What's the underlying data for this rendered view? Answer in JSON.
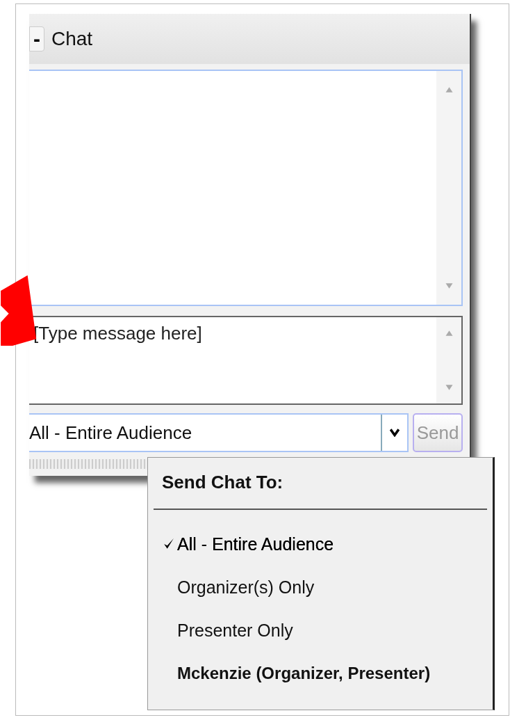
{
  "panel": {
    "title": "Chat",
    "collapse_symbol": "-"
  },
  "message_input": {
    "placeholder": "[Type message here]"
  },
  "recipient": {
    "value": "All - Entire Audience",
    "send_label": "Send",
    "send_disabled": true
  },
  "menu": {
    "title": "Send Chat To:",
    "items": [
      {
        "label": "All - Entire Audience",
        "selected": true,
        "kind": "group"
      },
      {
        "label": "Organizer(s) Only",
        "selected": false,
        "kind": "group"
      },
      {
        "label": "Presenter Only",
        "selected": false,
        "kind": "group"
      },
      {
        "label": "Mckenzie (Organizer, Presenter)",
        "selected": false,
        "kind": "person"
      }
    ]
  }
}
